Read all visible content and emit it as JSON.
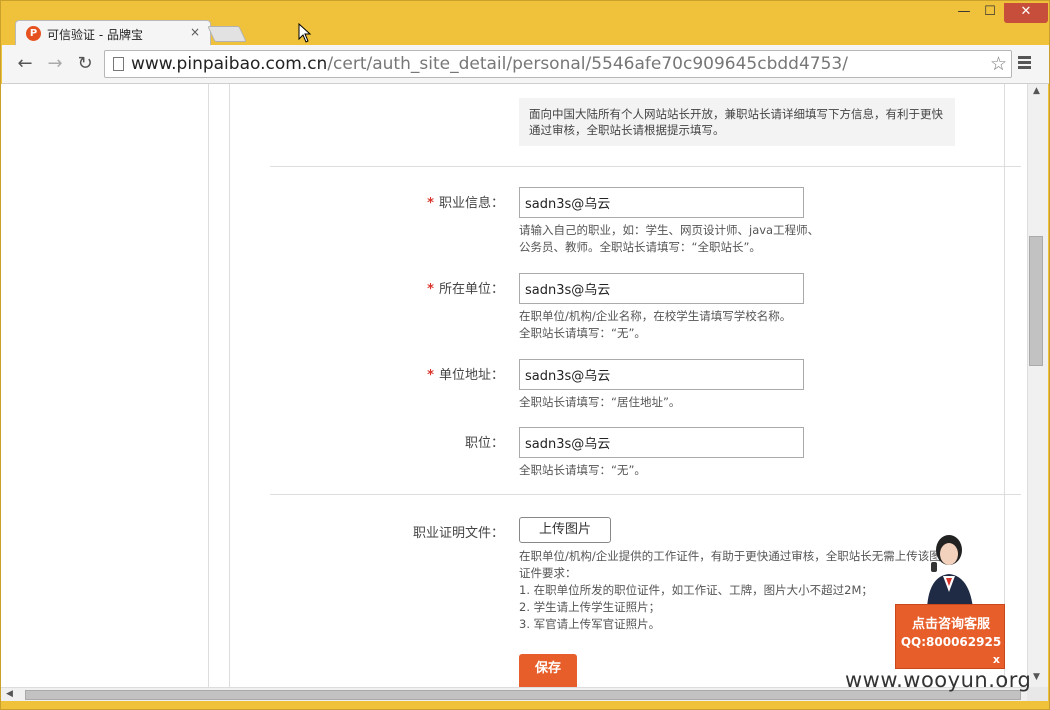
{
  "browser": {
    "tab_title": "可信验证 - 品牌宝",
    "tab_favicon_text": "P",
    "tab_close": "×",
    "url_host": "www.pinpaibao.com.cn",
    "url_path": "/cert/auth_site_detail/personal/5546afe70c909645cbdd4753/",
    "window_controls": {
      "minimize": "—",
      "maximize": "☐",
      "close": "✕"
    },
    "nav": {
      "back": "←",
      "forward": "→",
      "reload": "↻",
      "star": "☆"
    }
  },
  "form": {
    "intro_text": "面向中国大陆所有个人网站站长开放，兼职站长请详细填写下方信息，有利于更快通过审核，全职站长请根据提示填写。",
    "fields": [
      {
        "label": "职业信息：",
        "required": true,
        "value": "sadn3s@乌云",
        "hint_lines": [
          "请输入自己的职业，如：学生、网页设计师、java工程师、",
          "公务员、教师。全职站长请填写：“全职站长”。"
        ]
      },
      {
        "label": "所在单位：",
        "required": true,
        "value": "sadn3s@乌云",
        "hint_lines": [
          "在职单位/机构/企业名称，在校学生请填写学校名称。",
          "全职站长请填写：“无”。"
        ]
      },
      {
        "label": "单位地址：",
        "required": true,
        "value": "sadn3s@乌云",
        "hint_lines": [
          "全职站长请填写：“居住地址”。"
        ]
      },
      {
        "label": "职位：",
        "required": false,
        "value": "sadn3s@乌云",
        "hint_lines": [
          "全职站长请填写：“无”。"
        ]
      }
    ],
    "required_mark": "*",
    "upload": {
      "label": "职业证明文件：",
      "button": "上传图片",
      "hint_lines": [
        "在职单位/机构/企业提供的工作证件，有助于更快通过审核，全职站长无需上传该图片。",
        "证件要求：",
        "1. 在职单位所发的职位证件，如工作证、工牌，图片大小不超过2M；",
        "2. 学生请上传学生证照片；",
        "3. 军官请上传军官证照片。"
      ]
    },
    "save_button": "保存"
  },
  "consult": {
    "title": "点击咨询客服",
    "qq_label": "QQ:",
    "qq_number": "800062925",
    "close": "x"
  },
  "watermark": "www.wooyun.org",
  "colors": {
    "accent": "#e75e2a",
    "required": "#d9332b",
    "frame": "#f0c23b"
  }
}
